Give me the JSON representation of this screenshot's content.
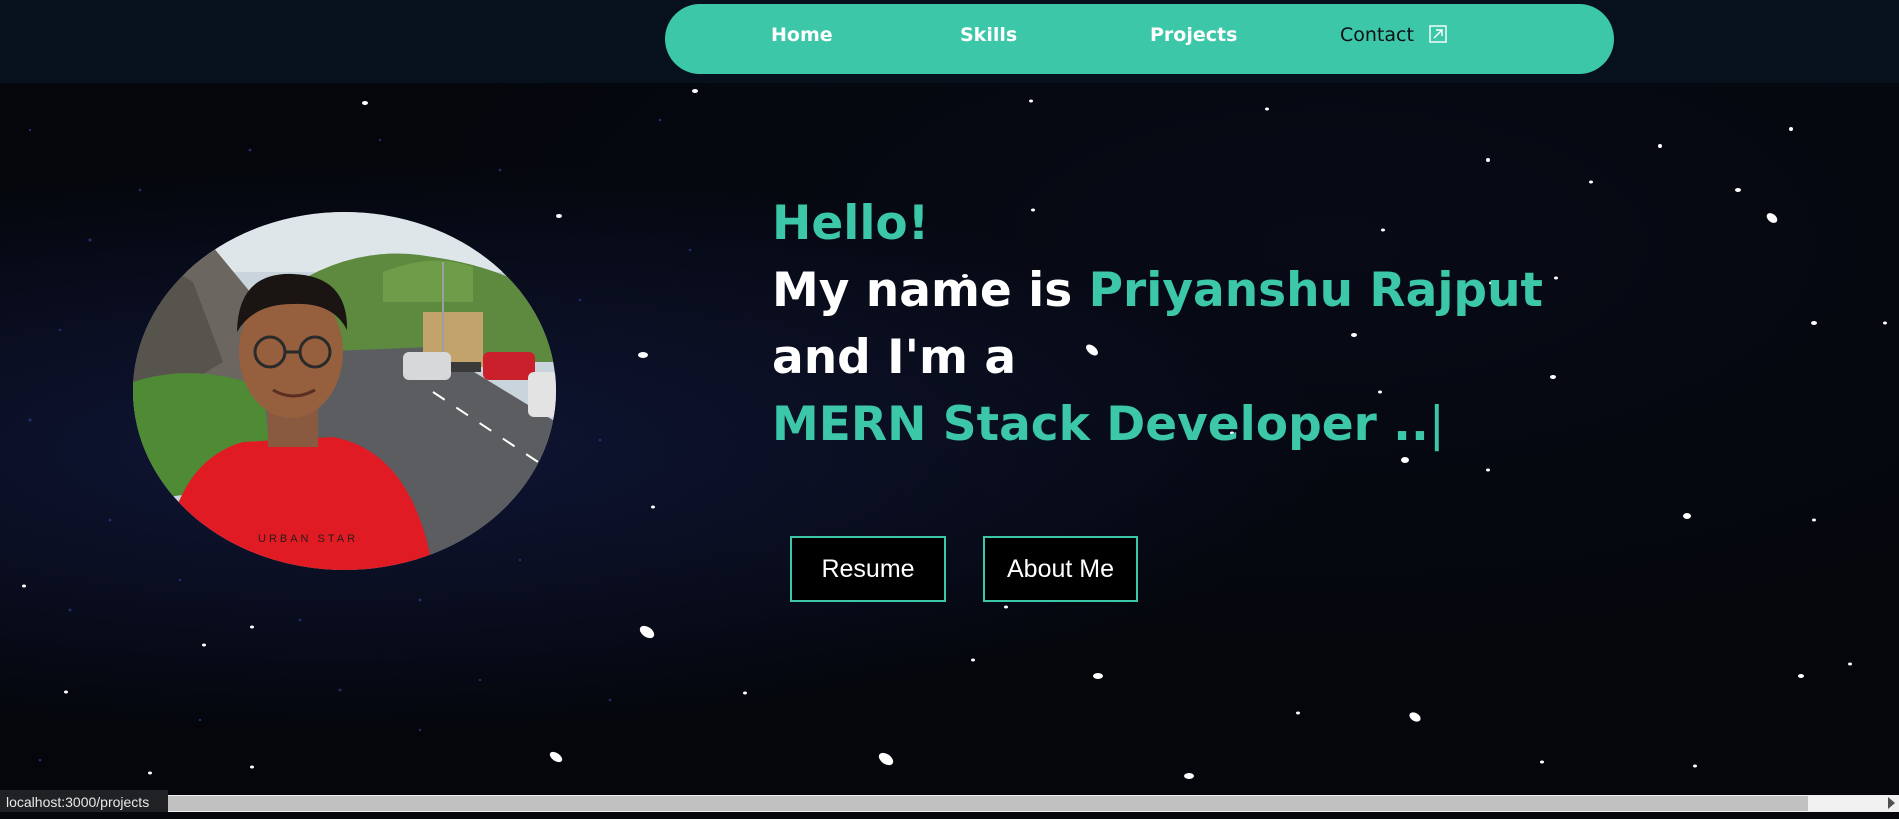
{
  "nav": {
    "items": [
      {
        "label": "Home"
      },
      {
        "label": "Skills"
      },
      {
        "label": "Projects"
      },
      {
        "label": "Contact"
      }
    ],
    "contact_icon": "external-link-icon",
    "pill_color": "#3cc7a8"
  },
  "hero": {
    "greeting": "Hello!",
    "intro_prefix": "My name is ",
    "name": "Priyanshu Rajput",
    "line3": "and I'm a",
    "role": "MERN Stack Developer ..",
    "cursor": "|",
    "photo_shirt_text": "URBAN STAR",
    "accent_color": "#3cc7a8"
  },
  "buttons": {
    "resume": "Resume",
    "about": "About Me"
  },
  "browser": {
    "status_url": "localhost:3000/projects"
  }
}
